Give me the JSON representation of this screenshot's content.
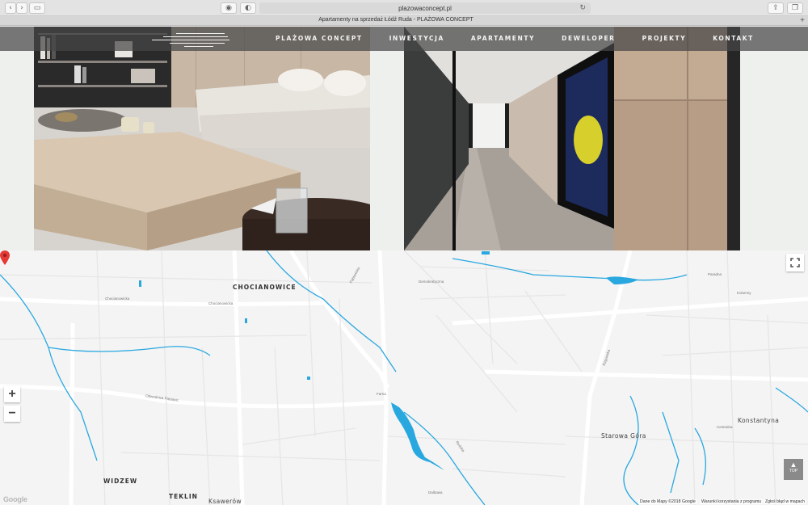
{
  "browser": {
    "url": "plazowaconcept.pl",
    "tab_title": "Apartamenty na sprzedaż Łódź Ruda - PLAŻOWA CONCEPT"
  },
  "nav": {
    "items": [
      "PLAŻOWA CONCEPT",
      "INWESTYCJA",
      "APARTAMENTY",
      "DEWELOPER",
      "PROJEKTY",
      "KONTAKT"
    ]
  },
  "map": {
    "labels": {
      "chocianowice": "CHOCIANOWICE",
      "widzew": "WIDZEW",
      "teklin": "TEKLIN",
      "konstantyna": "Konstantyna",
      "starowa_gora": "Starowa Góra",
      "ksawerow": "Ksawerów"
    },
    "streets": {
      "pabianicka": "Pabianicka",
      "chocianowicka": "Chocianowicka",
      "obwodnica": "Obwodnica Pabianic",
      "rzgowska": "Rzgowska",
      "demokratyczna": "Demokratyczna",
      "paradna": "Paradna",
      "kolumny": "Kolumny",
      "farna": "Farna",
      "rudzka": "Rudzka",
      "centralna": "Centralna",
      "dalbawa": "Dalbawa"
    },
    "controls": {
      "zoom_in": "+",
      "zoom_out": "−",
      "top": "TOP"
    },
    "attribution": {
      "google": "Google",
      "map_data": "Dane do Mapy ©2018 Google",
      "terms": "Warunki korzystania z programu",
      "report": "Zgłoś błąd w mapach"
    }
  },
  "colors": {
    "water": "#29a8e0",
    "pin": "#e53935",
    "navbar": "#4a4a4a"
  }
}
